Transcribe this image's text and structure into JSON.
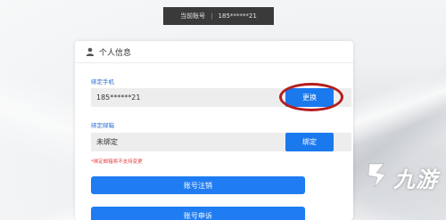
{
  "top_bar": {
    "label": "当前账号",
    "separator": "|",
    "account": "185******21"
  },
  "panel": {
    "title": "个人信息",
    "icon": "user-icon"
  },
  "phone": {
    "label": "绑定手机",
    "value": "185******21",
    "button": "更换"
  },
  "email": {
    "label": "绑定邮箱",
    "value": "未绑定",
    "button": "绑定",
    "hint": "*绑定邮箱将不支持变更"
  },
  "actions": {
    "cancel_account": "账号注销",
    "appeal": "账号申诉"
  },
  "watermark": {
    "text": "九游"
  },
  "colors": {
    "accent": "#1b79ee",
    "highlight_ring": "#b61d1d",
    "hint": "#e23c3c"
  }
}
